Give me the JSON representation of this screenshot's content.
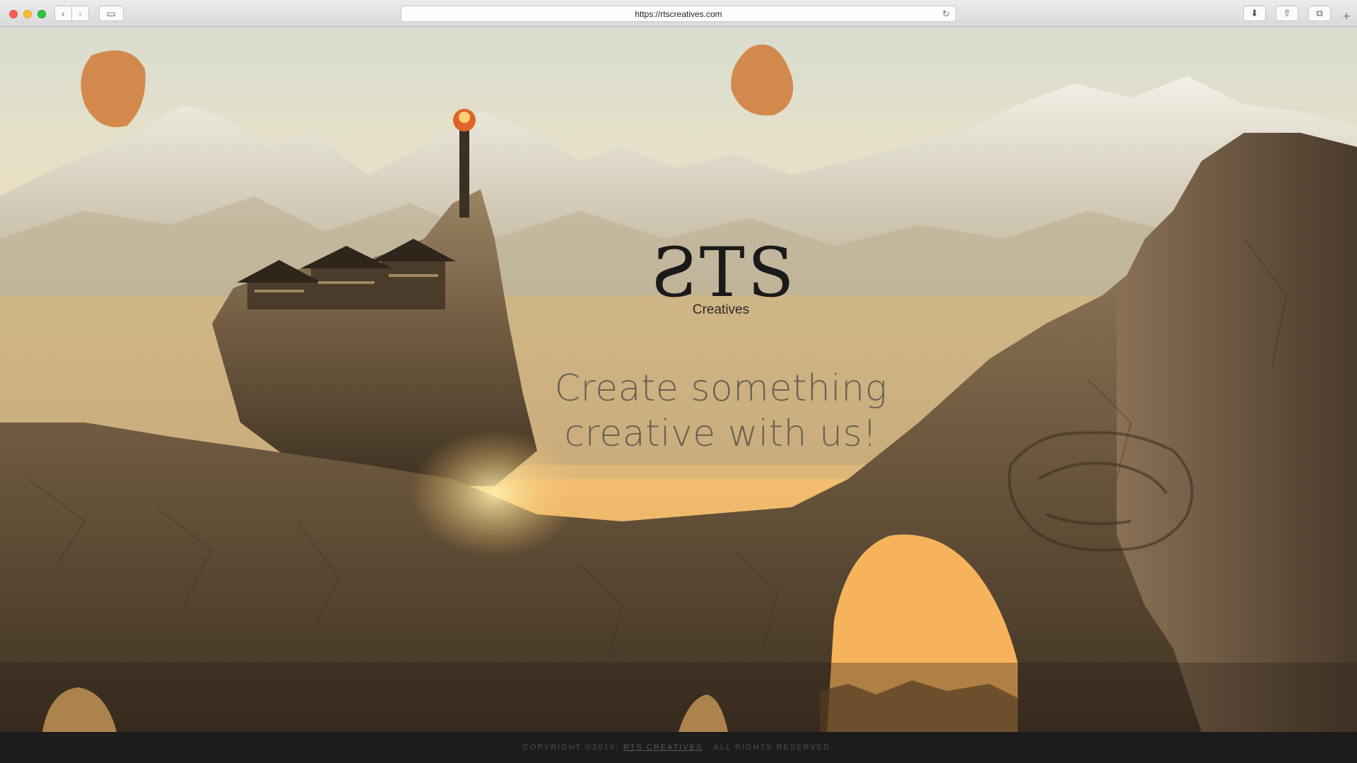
{
  "browser": {
    "url": "https://rtscreatives.com",
    "back_icon": "‹",
    "forward_icon": "›",
    "sidebar_icon": "▭",
    "reload_icon": "↻",
    "download_icon": "⬇",
    "share_icon": "⇧",
    "tabs_icon": "⧉",
    "new_tab_icon": "+"
  },
  "hero": {
    "logo_mark": "ƧTS",
    "logo_sub": "Creatives",
    "tagline_line1": "Create something",
    "tagline_line2": "creative with us!"
  },
  "footer": {
    "prefix": "COPYRIGHT ©2014.",
    "link": "RTS CREATIVES",
    "suffix": ". ALL RIGHTS RESERVED."
  },
  "colors": {
    "sky_top": "#d9dccf",
    "sky_warm": "#f3c37a",
    "rock": "#6b5a44",
    "footer_bg": "#1c1c1c"
  }
}
